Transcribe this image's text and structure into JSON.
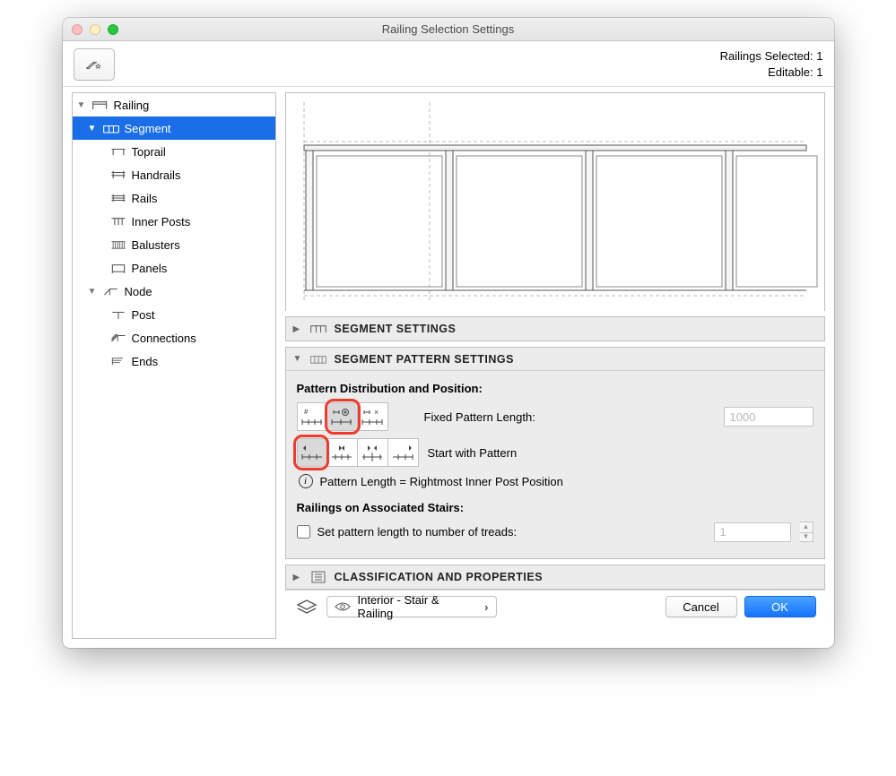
{
  "window": {
    "title": "Railing Selection Settings"
  },
  "status": {
    "selected_label": "Railings Selected: 1",
    "editable_label": "Editable: 1"
  },
  "tree": {
    "railing": "Railing",
    "segment": "Segment",
    "toprail": "Toprail",
    "handrails": "Handrails",
    "rails": "Rails",
    "inner_posts": "Inner Posts",
    "balusters": "Balusters",
    "panels": "Panels",
    "node": "Node",
    "post": "Post",
    "connections": "Connections",
    "ends": "Ends"
  },
  "zoom": {
    "plus": "+",
    "minus": "−"
  },
  "panels": {
    "segment_settings": "SEGMENT SETTINGS",
    "segment_pattern_settings": "SEGMENT PATTERN SETTINGS",
    "classification": "CLASSIFICATION AND PROPERTIES"
  },
  "pattern": {
    "section_title": "Pattern Distribution and Position:",
    "fixed_length_label": "Fixed Pattern Length:",
    "fixed_length_value": "1000",
    "start_with_pattern_label": "Start with Pattern",
    "info_text": "Pattern Length = Rightmost Inner Post Position"
  },
  "stairs": {
    "section_title": "Railings on Associated Stairs:",
    "checkbox_label": "Set pattern length to number of treads:",
    "treads_value": "1"
  },
  "layer": {
    "name": "Interior - Stair & Railing"
  },
  "buttons": {
    "cancel": "Cancel",
    "ok": "OK"
  }
}
